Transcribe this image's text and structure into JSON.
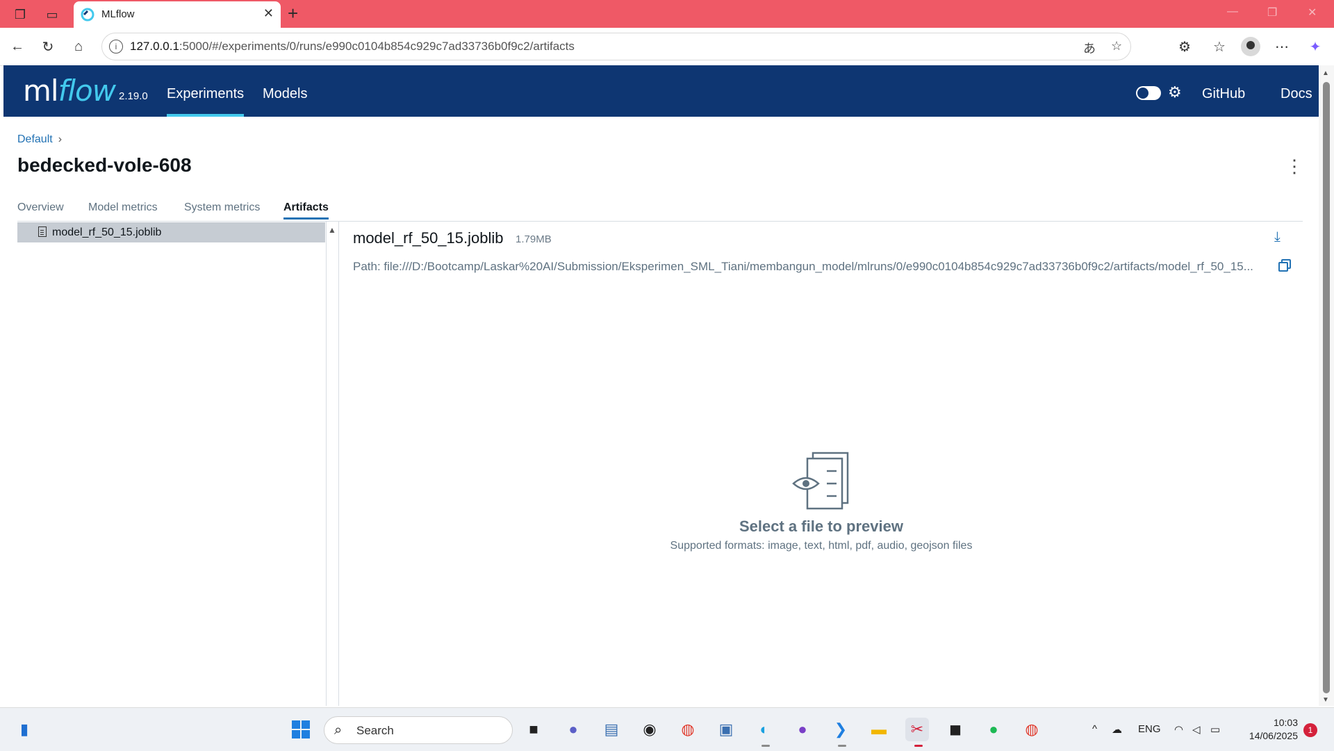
{
  "browser": {
    "tab_title": "MLflow",
    "url_host": "127.0.0.1",
    "url_rest": ":5000/#/experiments/0/runs/e990c0104b854c929c7ad33736b0f9c2/artifacts"
  },
  "header": {
    "logo_ml": "ml",
    "logo_flow": "flow",
    "version": "2.19.0",
    "nav": [
      "Experiments",
      "Models"
    ],
    "github": "GitHub",
    "docs": "Docs"
  },
  "page": {
    "breadcrumb": "Default",
    "run_name": "bedecked-vole-608",
    "tabs": [
      "Overview",
      "Model metrics",
      "System metrics",
      "Artifacts"
    ],
    "active_tab": "Artifacts"
  },
  "tree": {
    "items": [
      {
        "name": "model_rf_50_15.joblib"
      }
    ]
  },
  "artifact": {
    "name": "model_rf_50_15.joblib",
    "size": "1.79MB",
    "path": "Path: file:///D:/Bootcamp/Laskar%20AI/Submission/Eksperimen_SML_Tiani/membangun_model/mlruns/0/e990c0104b854c929c7ad33736b0f9c2/artifacts/model_rf_50_15..."
  },
  "preview": {
    "title": "Select a file to preview",
    "description": "Supported formats: image, text, html, pdf, audio, geojson files"
  },
  "taskbar": {
    "search_label": "Search",
    "language": "ENG",
    "time": "10:03",
    "date": "14/06/2025",
    "notification_count": "1"
  },
  "colors": {
    "header_bg": "#0e3672",
    "accent": "#43c9ed",
    "link": "#2272b4",
    "tabstrip": "#ef5966"
  }
}
